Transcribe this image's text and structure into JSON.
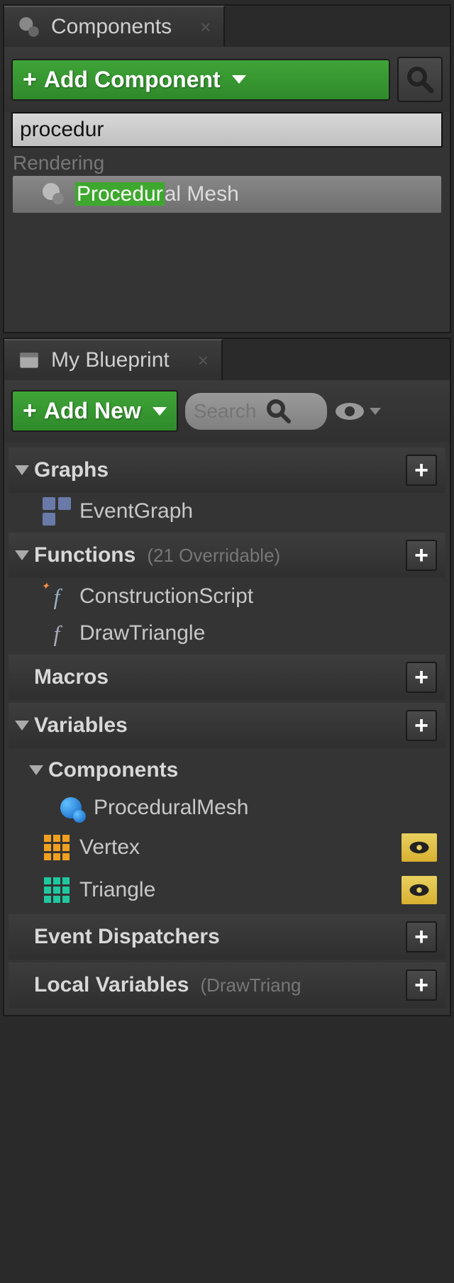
{
  "components_panel": {
    "title": "Components",
    "add_button": "Add Component",
    "search_value": "procedur",
    "category_label": "Rendering",
    "result_highlight": "Procedur",
    "result_rest": "al Mesh"
  },
  "blueprint_panel": {
    "title": "My Blueprint",
    "add_button": "Add New",
    "search_placeholder": "Search",
    "sections": {
      "graphs": {
        "label": "Graphs",
        "items": [
          "EventGraph"
        ]
      },
      "functions": {
        "label": "Functions",
        "sub": "(21 Overridable)",
        "items": [
          "ConstructionScript",
          "DrawTriangle"
        ]
      },
      "macros": {
        "label": "Macros"
      },
      "variables": {
        "label": "Variables"
      },
      "components": {
        "label": "Components",
        "items": [
          "ProceduralMesh",
          "Vertex",
          "Triangle"
        ]
      },
      "event_dispatchers": {
        "label": "Event Dispatchers"
      },
      "local_variables": {
        "label": "Local Variables",
        "sub": "(DrawTriang"
      }
    }
  }
}
